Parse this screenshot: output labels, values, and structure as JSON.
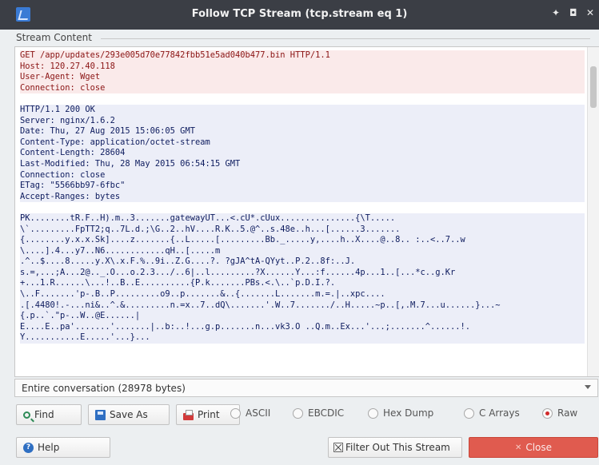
{
  "window": {
    "title": "Follow TCP Stream (tcp.stream eq 1)",
    "pin": "✦",
    "maximize": "◘",
    "close": "✕"
  },
  "group": {
    "label": "Stream Content"
  },
  "stream": {
    "client": [
      "GET /app/updates/293e005d70e77842fbb51e5ad040b477.bin HTTP/1.1",
      "Host: 120.27.40.118",
      "User-Agent: Wget",
      "Connection: close"
    ],
    "server_headers": [
      "HTTP/1.1 200 OK",
      "Server: nginx/1.6.2",
      "Date: Thu, 27 Aug 2015 15:06:05 GMT",
      "Content-Type: application/octet-stream",
      "Content-Length: 28604",
      "Last-Modified: Thu, 28 May 2015 06:54:15 GMT",
      "Connection: close",
      "ETag: \"5566bb97-6fbc\"",
      "Accept-Ranges: bytes"
    ],
    "server_body": [
      "PK........tR.F..H).m..3.......gatewayUT...<.cU*.cUux...............{\\T.....",
      "\\`.........FpTT2;q..7L.d.;\\G..2..hV....R.K..5.@^..s.48e..h...[......3.......",
      "{........y.x.x.Sk]....z.......{..L.....[.........Bb._.....y,....h..X....@..8.. :..<..7..w",
      "\\....].4...y7..N6............qH..[.....m",
      ".^..$....8.....y.X\\.x.F.%..9i..Z.G....?. ?gJA^tA-QYyt..P.2..8f:..J.",
      "s.=,...;A...2@.._.O...o.2.3.../..6|..l.........?X......Y...:f......4p...1..[...*c..g.Kr",
      "+...1.R......\\...!..B..E..........{P.k.......PBs.<.\\..`p.D.I.?.",
      "\\..F.......'p-.B..P.........o9..p.......&..{.......L.......m.=.|..xpc....",
      ".[.4480!.-...ni&..^.&.........n.=x..7..dQ\\.......'.W..7......./..H.....~p..[,.M.7...u......}...~",
      "{.p..`.\"p-..W..@E......|",
      "E....E..pa'.......'.......|..b:..!...g.p.......n...vk3.O ..Q.m..Ex...'...;.......^......!.",
      "Y...........E.....'...}..."
    ]
  },
  "conversation": {
    "selected": "Entire conversation (28978 bytes)"
  },
  "toolbar": {
    "find": "Find",
    "save_as": "Save As",
    "print": "Print"
  },
  "format": {
    "options": [
      "ASCII",
      "EBCDIC",
      "Hex Dump",
      "C Arrays",
      "Raw"
    ],
    "selected": "Raw"
  },
  "bottom": {
    "help": "Help",
    "filter": "Filter Out This Stream",
    "close": "Close"
  },
  "colors": {
    "client_text": "#8b1414",
    "client_bg": "#faeaea",
    "server_text": "#0d1b5e",
    "server_bg": "#eceef8",
    "close_button": "#e05b4f"
  }
}
